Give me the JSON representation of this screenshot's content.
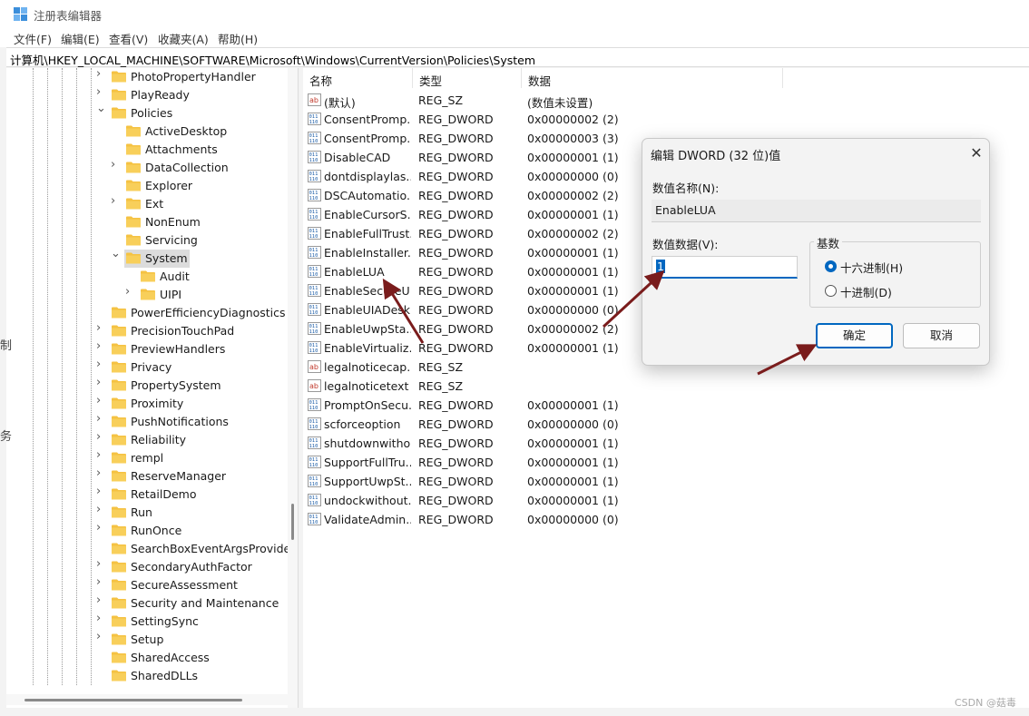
{
  "window": {
    "title": "注册表编辑器"
  },
  "menu": [
    "文件(F)",
    "编辑(E)",
    "查看(V)",
    "收藏夹(A)",
    "帮助(H)"
  ],
  "address": "计算机\\HKEY_LOCAL_MACHINE\\SOFTWARE\\Microsoft\\Windows\\CurrentVersion\\Policies\\System",
  "tree": {
    "items": [
      {
        "label": "PhotoPropertyHandler",
        "level": 0,
        "expandable": true
      },
      {
        "label": "PlayReady",
        "level": 0,
        "expandable": true
      },
      {
        "label": "Policies",
        "level": 0,
        "expandable": true,
        "expanded": true
      },
      {
        "label": "ActiveDesktop",
        "level": 1,
        "expandable": false
      },
      {
        "label": "Attachments",
        "level": 1,
        "expandable": false
      },
      {
        "label": "DataCollection",
        "level": 1,
        "expandable": true
      },
      {
        "label": "Explorer",
        "level": 1,
        "expandable": false
      },
      {
        "label": "Ext",
        "level": 1,
        "expandable": true
      },
      {
        "label": "NonEnum",
        "level": 1,
        "expandable": false
      },
      {
        "label": "Servicing",
        "level": 1,
        "expandable": false
      },
      {
        "label": "System",
        "level": 1,
        "expandable": true,
        "expanded": true,
        "selected": true
      },
      {
        "label": "Audit",
        "level": 2,
        "expandable": false
      },
      {
        "label": "UIPI",
        "level": 2,
        "expandable": true
      },
      {
        "label": "PowerEfficiencyDiagnostics",
        "level": 0,
        "expandable": false
      },
      {
        "label": "PrecisionTouchPad",
        "level": 0,
        "expandable": true
      },
      {
        "label": "PreviewHandlers",
        "level": 0,
        "expandable": true
      },
      {
        "label": "Privacy",
        "level": 0,
        "expandable": true
      },
      {
        "label": "PropertySystem",
        "level": 0,
        "expandable": true
      },
      {
        "label": "Proximity",
        "level": 0,
        "expandable": true
      },
      {
        "label": "PushNotifications",
        "level": 0,
        "expandable": true
      },
      {
        "label": "Reliability",
        "level": 0,
        "expandable": true
      },
      {
        "label": "rempl",
        "level": 0,
        "expandable": true
      },
      {
        "label": "ReserveManager",
        "level": 0,
        "expandable": true
      },
      {
        "label": "RetailDemo",
        "level": 0,
        "expandable": true
      },
      {
        "label": "Run",
        "level": 0,
        "expandable": true
      },
      {
        "label": "RunOnce",
        "level": 0,
        "expandable": true
      },
      {
        "label": "SearchBoxEventArgsProvide",
        "level": 0,
        "expandable": false
      },
      {
        "label": "SecondaryAuthFactor",
        "level": 0,
        "expandable": true
      },
      {
        "label": "SecureAssessment",
        "level": 0,
        "expandable": true
      },
      {
        "label": "Security and Maintenance",
        "level": 0,
        "expandable": true
      },
      {
        "label": "SettingSync",
        "level": 0,
        "expandable": true
      },
      {
        "label": "Setup",
        "level": 0,
        "expandable": true
      },
      {
        "label": "SharedAccess",
        "level": 0,
        "expandable": false
      },
      {
        "label": "SharedDLLs",
        "level": 0,
        "expandable": false
      }
    ]
  },
  "list": {
    "columns": [
      "名称",
      "类型",
      "数据"
    ],
    "rows": [
      {
        "icon": "string-value-icon",
        "name": "(默认)",
        "type": "REG_SZ",
        "data": "(数值未设置)"
      },
      {
        "icon": "binary-value-icon",
        "name": "ConsentPromp...",
        "type": "REG_DWORD",
        "data": "0x00000002 (2)"
      },
      {
        "icon": "binary-value-icon",
        "name": "ConsentPromp...",
        "type": "REG_DWORD",
        "data": "0x00000003 (3)"
      },
      {
        "icon": "binary-value-icon",
        "name": "DisableCAD",
        "type": "REG_DWORD",
        "data": "0x00000001 (1)"
      },
      {
        "icon": "binary-value-icon",
        "name": "dontdisplaylas...",
        "type": "REG_DWORD",
        "data": "0x00000000 (0)"
      },
      {
        "icon": "binary-value-icon",
        "name": "DSCAutomatio...",
        "type": "REG_DWORD",
        "data": "0x00000002 (2)"
      },
      {
        "icon": "binary-value-icon",
        "name": "EnableCursorS...",
        "type": "REG_DWORD",
        "data": "0x00000001 (1)"
      },
      {
        "icon": "binary-value-icon",
        "name": "EnableFullTrust...",
        "type": "REG_DWORD",
        "data": "0x00000002 (2)"
      },
      {
        "icon": "binary-value-icon",
        "name": "EnableInstaller...",
        "type": "REG_DWORD",
        "data": "0x00000001 (1)"
      },
      {
        "icon": "binary-value-icon",
        "name": "EnableLUA",
        "type": "REG_DWORD",
        "data": "0x00000001 (1)"
      },
      {
        "icon": "binary-value-icon",
        "name": "EnableSecureU...",
        "type": "REG_DWORD",
        "data": "0x00000001 (1)"
      },
      {
        "icon": "binary-value-icon",
        "name": "EnableUIADesk...",
        "type": "REG_DWORD",
        "data": "0x00000000 (0)"
      },
      {
        "icon": "binary-value-icon",
        "name": "EnableUwpSta...",
        "type": "REG_DWORD",
        "data": "0x00000002 (2)"
      },
      {
        "icon": "binary-value-icon",
        "name": "EnableVirtualiz...",
        "type": "REG_DWORD",
        "data": "0x00000001 (1)"
      },
      {
        "icon": "string-value-icon",
        "name": "legalnoticecap...",
        "type": "REG_SZ",
        "data": ""
      },
      {
        "icon": "string-value-icon",
        "name": "legalnoticetext",
        "type": "REG_SZ",
        "data": ""
      },
      {
        "icon": "binary-value-icon",
        "name": "PromptOnSecu...",
        "type": "REG_DWORD",
        "data": "0x00000001 (1)"
      },
      {
        "icon": "binary-value-icon",
        "name": "scforceoption",
        "type": "REG_DWORD",
        "data": "0x00000000 (0)"
      },
      {
        "icon": "binary-value-icon",
        "name": "shutdownwitho...",
        "type": "REG_DWORD",
        "data": "0x00000001 (1)"
      },
      {
        "icon": "binary-value-icon",
        "name": "SupportFullTru...",
        "type": "REG_DWORD",
        "data": "0x00000001 (1)"
      },
      {
        "icon": "binary-value-icon",
        "name": "SupportUwpSt...",
        "type": "REG_DWORD",
        "data": "0x00000001 (1)"
      },
      {
        "icon": "binary-value-icon",
        "name": "undockwithout...",
        "type": "REG_DWORD",
        "data": "0x00000001 (1)"
      },
      {
        "icon": "binary-value-icon",
        "name": "ValidateAdmin...",
        "type": "REG_DWORD",
        "data": "0x00000000 (0)"
      }
    ]
  },
  "dialog": {
    "title": "编辑 DWORD (32 位)值",
    "close": "✕",
    "name_label": "数值名称(N):",
    "name_value": "EnableLUA",
    "data_label": "数值数据(V):",
    "data_value": "1",
    "base_label": "基数",
    "radio_hex": "十六进制(H)",
    "radio_dec": "十进制(D)",
    "ok": "确定",
    "cancel": "取消"
  },
  "side_glyphs": [
    "制",
    "务"
  ],
  "watermark": "CSDN @菇毒",
  "colors": {
    "accent": "#0067c0",
    "folder": "#f5c242",
    "arrow": "#7a1c1c"
  }
}
